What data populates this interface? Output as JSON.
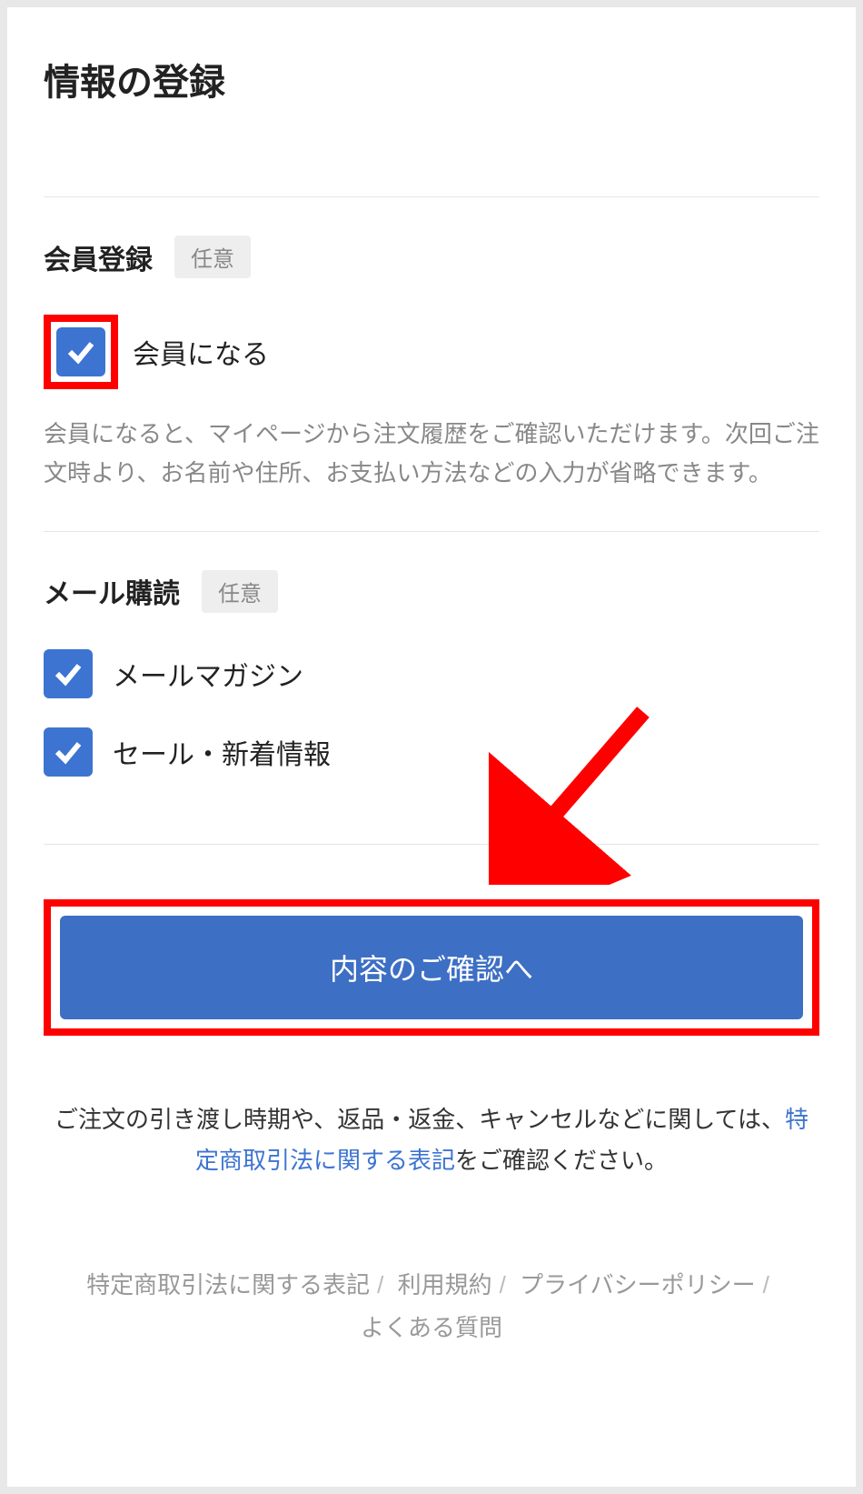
{
  "page": {
    "title": "情報の登録"
  },
  "sections": {
    "member": {
      "title": "会員登録",
      "badge": "任意",
      "checkbox_label": "会員になる",
      "helper": "会員になると、マイページから注文履歴をご確認いただけます。次回ご注文時より、お名前や住所、お支払い方法などの入力が省略できます。"
    },
    "mail": {
      "title": "メール購読",
      "badge": "任意",
      "items": [
        {
          "label": "メールマガジン"
        },
        {
          "label": "セール・新着情報"
        }
      ]
    }
  },
  "button": {
    "confirm": "内容のご確認へ"
  },
  "notice": {
    "prefix": "ご注文の引き渡し時期や、返品・返金、キャンセルなどに関しては、",
    "link": "特定商取引法に関する表記",
    "suffix": "をご確認ください。"
  },
  "footer": {
    "links": [
      "特定商取引法に関する表記",
      "利用規約",
      "プライバシーポリシー",
      "よくある質問"
    ]
  },
  "colors": {
    "primary": "#3d74d1",
    "highlight": "#ff0000"
  }
}
